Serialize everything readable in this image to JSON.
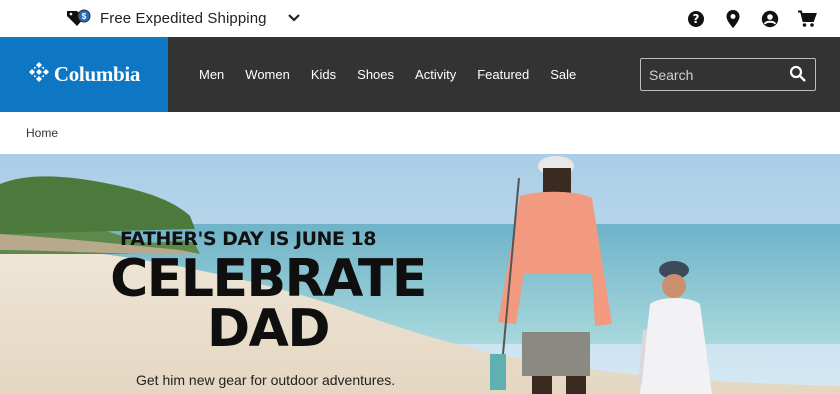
{
  "utility_bar": {
    "shipping_text": "Free Expedited Shipping",
    "icons": [
      "help-icon",
      "location-icon",
      "account-icon",
      "cart-icon"
    ]
  },
  "brand": {
    "name": "Columbia",
    "color": "#0d77c4"
  },
  "nav": {
    "items": [
      "Men",
      "Women",
      "Kids",
      "Shoes",
      "Activity",
      "Featured",
      "Sale"
    ],
    "background": "#333333"
  },
  "search": {
    "placeholder": "Search"
  },
  "breadcrumb": {
    "home": "Home"
  },
  "hero": {
    "eyebrow": "FATHER'S DAY IS JUNE 18",
    "headline_line1": "CELEBRATE",
    "headline_line2": "DAD",
    "subtext": "Get him new gear for outdoor adventures."
  }
}
